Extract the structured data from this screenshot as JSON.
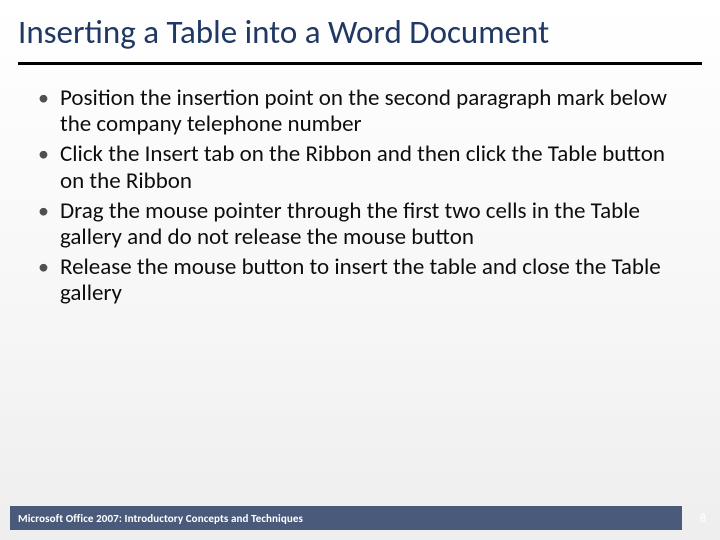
{
  "title": "Inserting a Table into a Word Document",
  "bullets": [
    "Position the insertion point on the second paragraph mark below the company telephone number",
    "Click the Insert tab on the Ribbon and then click the Table button on the Ribbon",
    "Drag the mouse pointer through the first two cells in the Table gallery and do not release the mouse button",
    "Release the mouse button to insert the table and close the Table gallery"
  ],
  "footer": "Microsoft Office 2007: Introductory Concepts and Techniques",
  "page_number": "8"
}
